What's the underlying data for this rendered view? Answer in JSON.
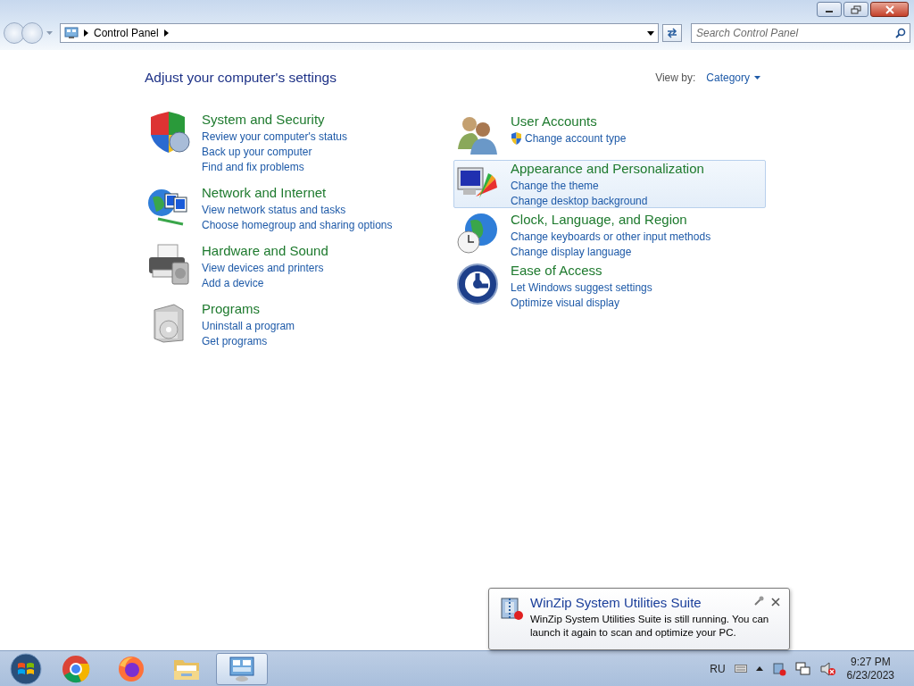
{
  "address_bar": {
    "path": "Control Panel",
    "search_placeholder": "Search Control Panel"
  },
  "header": {
    "title": "Adjust your computer's settings",
    "view_by_label": "View by:",
    "view_by_value": "Category"
  },
  "columns": [
    [
      {
        "title": "System and Security",
        "highlighted": false,
        "links": [
          {
            "text": "Review your computer's status",
            "admin": false
          },
          {
            "text": "Back up your computer",
            "admin": false
          },
          {
            "text": "Find and fix problems",
            "admin": false
          }
        ]
      },
      {
        "title": "Network and Internet",
        "highlighted": false,
        "links": [
          {
            "text": "View network status and tasks",
            "admin": false
          },
          {
            "text": "Choose homegroup and sharing options",
            "admin": false
          }
        ]
      },
      {
        "title": "Hardware and Sound",
        "highlighted": false,
        "links": [
          {
            "text": "View devices and printers",
            "admin": false
          },
          {
            "text": "Add a device",
            "admin": false
          }
        ]
      },
      {
        "title": "Programs",
        "highlighted": false,
        "links": [
          {
            "text": "Uninstall a program",
            "admin": false
          },
          {
            "text": "Get programs",
            "admin": false
          }
        ]
      }
    ],
    [
      {
        "title": "User Accounts",
        "highlighted": false,
        "links": [
          {
            "text": "Change account type",
            "admin": true
          }
        ]
      },
      {
        "title": "Appearance and Personalization",
        "highlighted": true,
        "links": [
          {
            "text": "Change the theme",
            "admin": false
          },
          {
            "text": "Change desktop background",
            "admin": false
          }
        ]
      },
      {
        "title": "Clock, Language, and Region",
        "highlighted": false,
        "links": [
          {
            "text": "Change keyboards or other input methods",
            "admin": false
          },
          {
            "text": "Change display language",
            "admin": false
          }
        ]
      },
      {
        "title": "Ease of Access",
        "highlighted": false,
        "links": [
          {
            "text": "Let Windows suggest settings",
            "admin": false
          },
          {
            "text": "Optimize visual display",
            "admin": false
          }
        ]
      }
    ]
  ],
  "notification": {
    "title": "WinZip System Utilities Suite",
    "message": "WinZip System Utilities Suite is still running. You can launch it again to scan and optimize your PC."
  },
  "taskbar": {
    "apps": [
      {
        "selected": false
      },
      {
        "selected": false
      },
      {
        "selected": false
      },
      {
        "selected": true
      }
    ],
    "language": "RU",
    "time": "9:27 PM",
    "date": "6/23/2023"
  }
}
